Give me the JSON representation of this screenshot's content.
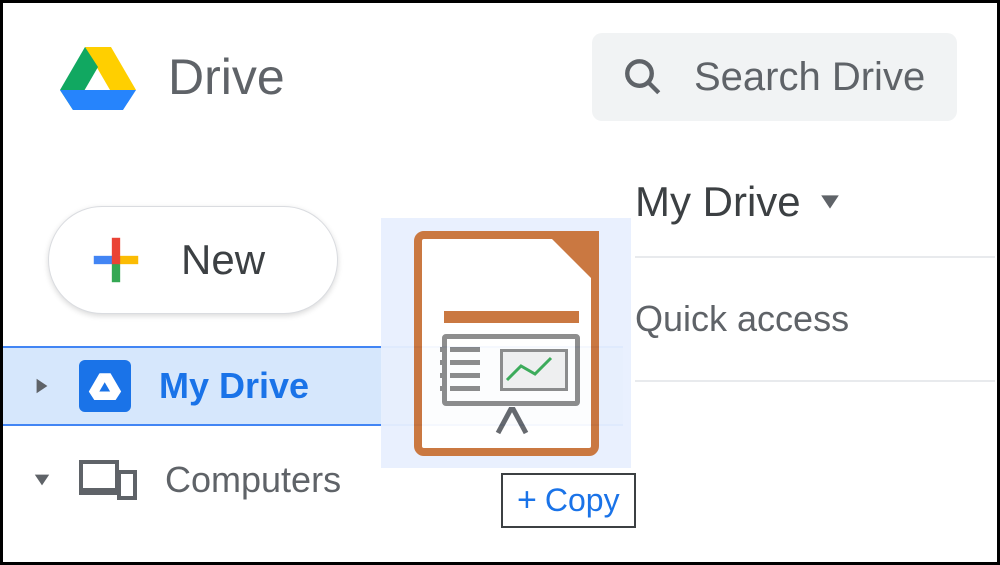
{
  "header": {
    "app_title": "Drive",
    "search_placeholder": "Search Drive"
  },
  "sidebar": {
    "new_button_label": "New",
    "items": [
      {
        "label": "My Drive"
      },
      {
        "label": "Computers"
      }
    ]
  },
  "main": {
    "heading": "My Drive",
    "quick_access_label": "Quick access"
  },
  "drag": {
    "tooltip_label": "Copy"
  }
}
